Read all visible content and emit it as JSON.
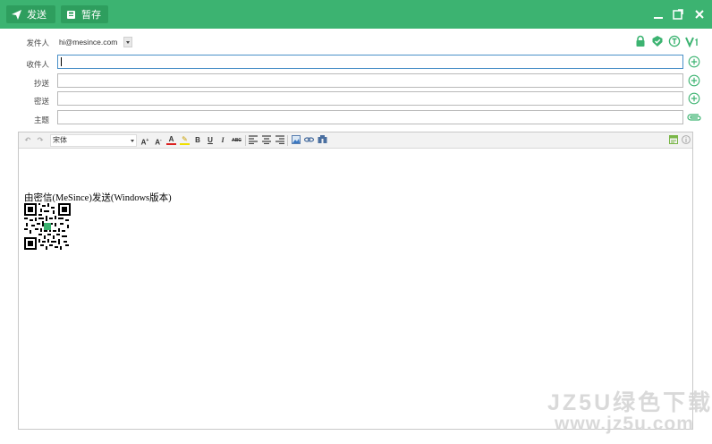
{
  "toolbar": {
    "send_label": "发送",
    "draft_label": "暂存"
  },
  "form": {
    "sender_label": "发件人",
    "sender_value": "hi@mesince.com",
    "to_label": "收件人",
    "cc_label": "抄送",
    "bcc_label": "密送",
    "subject_label": "主题"
  },
  "editor": {
    "font_name": "宋体",
    "signature": "由密信(MeSince)发送(Windows版本)"
  },
  "watermark": {
    "line1": "JZ5U绿色下载",
    "line2": "www.jz5u.com"
  },
  "colors": {
    "brand": "#3cb371",
    "brand_dark": "#2e9e5e",
    "focus": "#4a90c8"
  },
  "icons": [
    "send-icon",
    "draft-icon",
    "minimize-icon",
    "maximize-icon",
    "close-icon",
    "lock-icon",
    "shield-check-icon",
    "timer-icon",
    "v1-icon",
    "add-contact-icon",
    "attachment-icon"
  ]
}
